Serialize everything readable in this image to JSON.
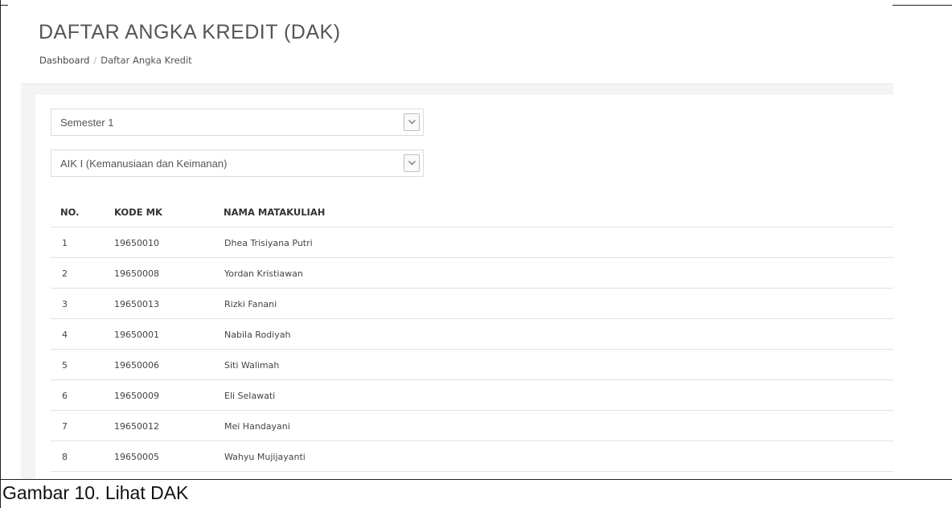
{
  "page_title": "DAFTAR ANGKA KREDIT (DAK)",
  "breadcrumb": {
    "home": "Dashboard",
    "separator": "/",
    "current": "Daftar Angka Kredit"
  },
  "filters": {
    "semester": "Semester 1",
    "matakuliah": "AIK I (Kemanusiaan dan Keimanan)"
  },
  "table": {
    "headers": {
      "no": "NO.",
      "kode": "KODE MK",
      "nama": "NAMA MATAKULIAH"
    },
    "rows": [
      {
        "no": "1",
        "kode": "19650010",
        "nama": "Dhea Trisiyana Putri"
      },
      {
        "no": "2",
        "kode": "19650008",
        "nama": "Yordan Kristiawan"
      },
      {
        "no": "3",
        "kode": "19650013",
        "nama": "Rizki Fanani"
      },
      {
        "no": "4",
        "kode": "19650001",
        "nama": "Nabila Rodiyah"
      },
      {
        "no": "5",
        "kode": "19650006",
        "nama": "Siti Walimah"
      },
      {
        "no": "6",
        "kode": "19650009",
        "nama": "Eli Selawati"
      },
      {
        "no": "7",
        "kode": "19650012",
        "nama": "Mei Handayani"
      },
      {
        "no": "8",
        "kode": "19650005",
        "nama": "Wahyu Mujijayanti"
      }
    ]
  },
  "caption": "Gambar 10. Lihat DAK"
}
